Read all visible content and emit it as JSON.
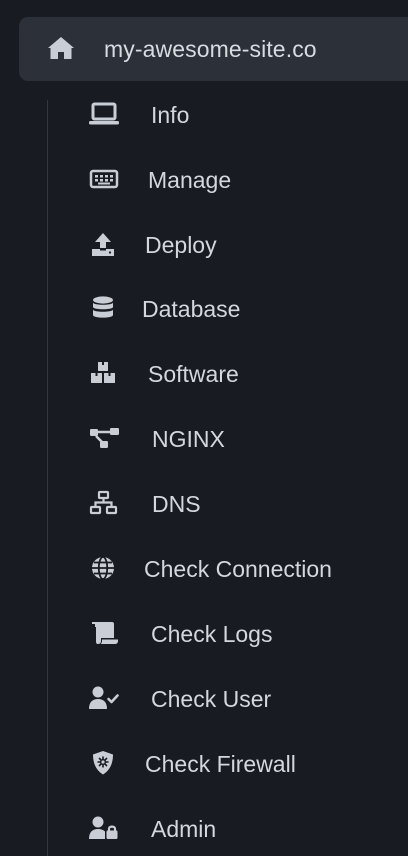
{
  "site": {
    "name": "my-awesome-site.co",
    "icon": "home-icon"
  },
  "menu": {
    "items": [
      {
        "label": "Info",
        "icon": "laptop-icon"
      },
      {
        "label": "Manage",
        "icon": "keyboard-icon"
      },
      {
        "label": "Deploy",
        "icon": "upload-icon"
      },
      {
        "label": "Database",
        "icon": "database-icon"
      },
      {
        "label": "Software",
        "icon": "boxes-icon"
      },
      {
        "label": "NGINX",
        "icon": "flow-icon"
      },
      {
        "label": "DNS",
        "icon": "network-icon"
      },
      {
        "label": "Check Connection",
        "icon": "globe-icon"
      },
      {
        "label": "Check Logs",
        "icon": "scroll-icon"
      },
      {
        "label": "Check User",
        "icon": "user-check-icon"
      },
      {
        "label": "Check Firewall",
        "icon": "shield-virus-icon"
      },
      {
        "label": "Admin",
        "icon": "user-lock-icon"
      }
    ]
  },
  "colors": {
    "background": "#181b21",
    "header_background": "#2b3039",
    "text": "#d3d7de",
    "icon": "#c9ced6"
  }
}
